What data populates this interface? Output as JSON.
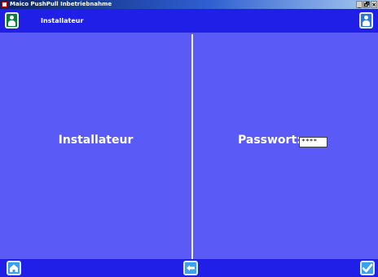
{
  "window": {
    "title": "Maico PushPull Inbetriebnahme",
    "buttons": [
      "_",
      "🗗",
      "×"
    ]
  },
  "header": {
    "title": "Installateur",
    "left_icon": "user-icon",
    "right_icon": "user-icon"
  },
  "main": {
    "left_label": "Installateur",
    "password_label": "Passwort:",
    "password_value": "****"
  },
  "footer": {
    "buttons": [
      "home-icon",
      "back-arrow-icon",
      "checkmark-icon"
    ]
  },
  "colors": {
    "header_bg": "#1f1fe8",
    "panel_bg": "#5a5af6",
    "divider": "#f2f2ff"
  }
}
